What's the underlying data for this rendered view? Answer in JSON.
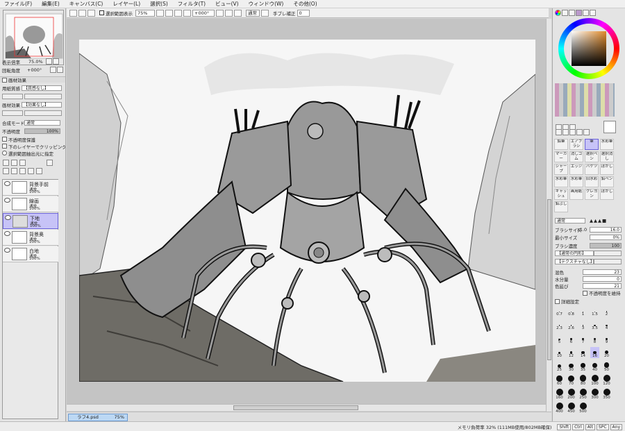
{
  "menu": [
    "ファイル(F)",
    "編集(E)",
    "キャンバス(C)",
    "レイヤー(L)",
    "選択(S)",
    "フィルタ(T)",
    "ビュー(V)",
    "ウィンドウ(W)",
    "その他(O)"
  ],
  "toolbar": {
    "selection_display": "選択範囲表示",
    "zoom": "75%",
    "rotation": "+000°",
    "mode": "通常",
    "stabilizer_label": "手ブレ補正",
    "stabilizer_value": "0"
  },
  "left": {
    "display_scale_label": "表示倍率",
    "display_scale_value": "75.0%",
    "rotation_label": "回転角度",
    "rotation_value": "+000°",
    "paper_effect_title": "画材効果",
    "paper_texture_label": "用紙質感",
    "paper_texture_value": "【質感なし】",
    "material_effect_label": "画材効果",
    "material_effect_value": "【効果なし】",
    "blend_mode_label": "合成モード",
    "blend_mode_value": "通常",
    "opacity_label": "不透明度",
    "opacity_value": "100%",
    "protect_opacity": "不透明度保護",
    "clip_lower": "下のレイヤーでクリッピング",
    "selection_source": "選択範囲抽出元に指定",
    "layers": [
      {
        "name": "背景手前",
        "mode": "通常",
        "opacity": "100%"
      },
      {
        "name": "線画",
        "mode": "通常",
        "opacity": "100%"
      },
      {
        "name": "下地",
        "mode": "通常",
        "opacity": "100%"
      },
      {
        "name": "背景奥",
        "mode": "通常",
        "opacity": "100%"
      },
      {
        "name": "白地",
        "mode": "通常",
        "opacity": "100%"
      }
    ]
  },
  "right": {
    "tools": [
      "鉛筆",
      "エアブラシ",
      "筆",
      "水彩筆",
      "マーカー",
      "消しゴム",
      "選択ペン",
      "選択消し",
      "シャープ",
      "エッジ",
      "バケツ",
      "ぼかし",
      "水彩筆",
      "水彩筆",
      "旧水彩",
      "鉛ペン",
      "ギャッシュ",
      "画用紙",
      "クレヨン",
      "ぼかし",
      "鉛ぶし"
    ],
    "brush_mode": "通常",
    "brush_size_label": "ブラシサイズ",
    "brush_size_mult": "x1.0",
    "brush_size_value": "16.0",
    "min_size_label": "最小サイズ",
    "min_size_value": "0%",
    "brush_density_label": "ブラシ濃度",
    "brush_density_value": "100",
    "normal_shape": "【通常の円形】",
    "no_texture": "【テクスチャなし】",
    "mix_label": "混色",
    "mix_value": "23",
    "water_label": "水分量",
    "water_value": "0",
    "blur_label": "色延び",
    "blur_value": "21",
    "keep_opacity": "不透明度を維持",
    "detail_label": "詳細設定",
    "brush_sizes": [
      "0.7",
      "0.8",
      "1",
      "1.5",
      "2",
      "2.3",
      "2.6",
      "3",
      "3.5",
      "4",
      "5",
      "6",
      "7",
      "8",
      "9",
      "10",
      "12",
      "14",
      "16",
      "20",
      "25",
      "30",
      "35",
      "40",
      "50",
      "60",
      "70",
      "80",
      "100",
      "120",
      "160",
      "200",
      "250",
      "300",
      "350",
      "400",
      "450",
      "500"
    ]
  },
  "doc_tab": "ラフ4.psd",
  "doc_zoom": "75%",
  "status": "メモリ負荷率 32% (111MB使用/802MB確保)",
  "status_keys": [
    "Shift",
    "Ctrl",
    "Alt",
    "SPC",
    "Any"
  ],
  "colors": {
    "selection": "#c7c3f7",
    "accent": "#6a62d8"
  }
}
